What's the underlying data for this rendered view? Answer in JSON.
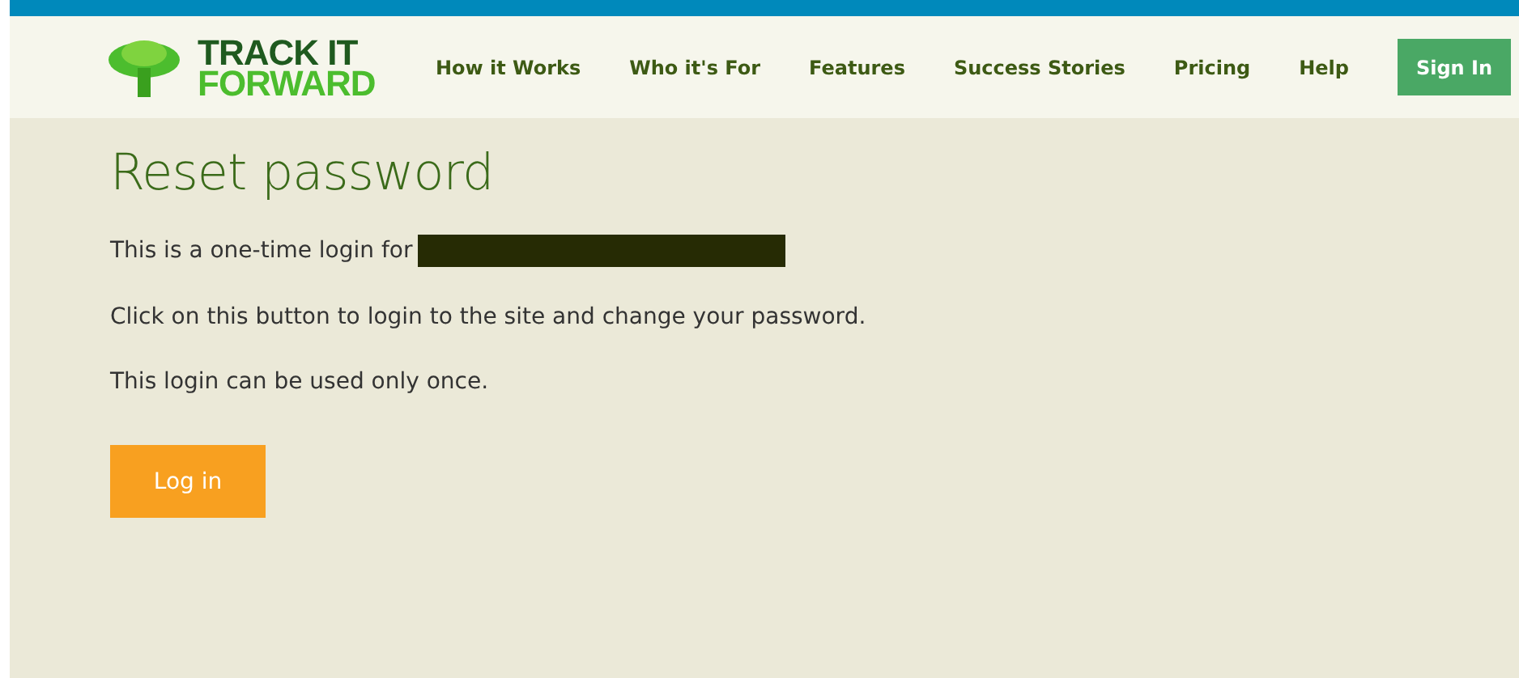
{
  "header": {
    "logo": {
      "line_1": "TRACK IT",
      "line_2": "FORWARD"
    },
    "nav": [
      {
        "label": "How it Works"
      },
      {
        "label": "Who it's For"
      },
      {
        "label": "Features"
      },
      {
        "label": "Success Stories"
      },
      {
        "label": "Pricing"
      },
      {
        "label": "Help"
      }
    ],
    "sign_in": "Sign In"
  },
  "main": {
    "title": "Reset password",
    "paragraphs": [
      "This is a one-time login for",
      "Click on this button to login to the site and change your password.",
      "This login can be used only once."
    ],
    "button": "Log in"
  }
}
